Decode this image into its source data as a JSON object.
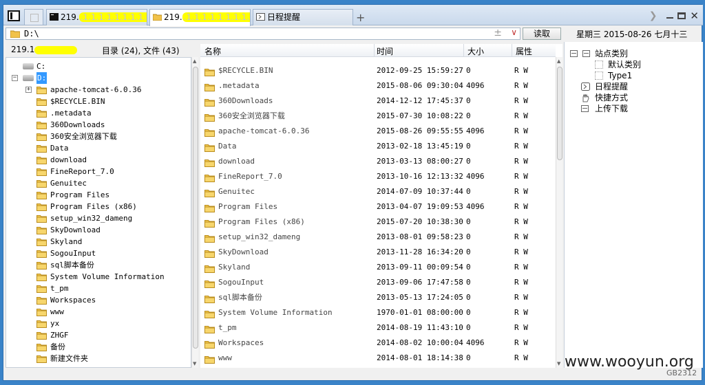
{
  "tabs": [
    {
      "label": "219.",
      "icon": "terminal-icon"
    },
    {
      "label": "219.",
      "icon": "folder-icon"
    },
    {
      "label": "日程提醒",
      "icon": "clock-icon"
    }
  ],
  "tab_add": "+",
  "toolbar": {
    "read_label": "读取"
  },
  "address": {
    "value": "D:\\"
  },
  "date_display": "星期三  2015-08-26  七月十三",
  "left": {
    "host": "219.1",
    "dir_summary": "目录 (24), 文件 (43)",
    "tree": [
      {
        "label": "C:",
        "level": "drive",
        "expand": ""
      },
      {
        "label": "D:",
        "level": "drive",
        "expand": "−",
        "selected": true
      },
      {
        "label": "apache-tomcat-6.0.36",
        "level": "folder",
        "expand": "+"
      },
      {
        "label": "$RECYCLE.BIN",
        "level": "folder",
        "expand": ""
      },
      {
        "label": ".metadata",
        "level": "folder",
        "expand": ""
      },
      {
        "label": "360Downloads",
        "level": "folder",
        "expand": ""
      },
      {
        "label": "360安全浏览器下载",
        "level": "folder",
        "expand": ""
      },
      {
        "label": "Data",
        "level": "folder",
        "expand": ""
      },
      {
        "label": "download",
        "level": "folder",
        "expand": ""
      },
      {
        "label": "FineReport_7.0",
        "level": "folder",
        "expand": ""
      },
      {
        "label": "Genuitec",
        "level": "folder",
        "expand": ""
      },
      {
        "label": "Program Files",
        "level": "folder",
        "expand": ""
      },
      {
        "label": "Program Files (x86)",
        "level": "folder",
        "expand": ""
      },
      {
        "label": "setup_win32_dameng",
        "level": "folder",
        "expand": ""
      },
      {
        "label": "SkyDownload",
        "level": "folder",
        "expand": ""
      },
      {
        "label": "Skyland",
        "level": "folder",
        "expand": ""
      },
      {
        "label": "SogouInput",
        "level": "folder",
        "expand": ""
      },
      {
        "label": "sql脚本备份",
        "level": "folder",
        "expand": ""
      },
      {
        "label": "System Volume Information",
        "level": "folder",
        "expand": ""
      },
      {
        "label": "t_pm",
        "level": "folder",
        "expand": ""
      },
      {
        "label": "Workspaces",
        "level": "folder",
        "expand": ""
      },
      {
        "label": "www",
        "level": "folder",
        "expand": ""
      },
      {
        "label": "yx",
        "level": "folder",
        "expand": ""
      },
      {
        "label": "ZHGF",
        "level": "folder",
        "expand": ""
      },
      {
        "label": "备份",
        "level": "folder",
        "expand": ""
      },
      {
        "label": "新建文件夹",
        "level": "folder",
        "expand": ""
      }
    ]
  },
  "files": {
    "columns": {
      "name": "名称",
      "time": "时间",
      "size": "大小",
      "attr": "属性"
    },
    "rows": [
      {
        "name": "$RECYCLE.BIN",
        "time": "2012-09-25 15:59:27",
        "size": "0",
        "attr": "R W"
      },
      {
        "name": ".metadata",
        "time": "2015-08-06 09:30:04",
        "size": "4096",
        "attr": "R W"
      },
      {
        "name": "360Downloads",
        "time": "2014-12-12 17:45:37",
        "size": "0",
        "attr": "R W"
      },
      {
        "name": "360安全浏览器下载",
        "time": "2015-07-30 10:08:22",
        "size": "0",
        "attr": "R W"
      },
      {
        "name": "apache-tomcat-6.0.36",
        "time": "2015-08-26 09:55:55",
        "size": "4096",
        "attr": "R W"
      },
      {
        "name": "Data",
        "time": "2013-02-18 13:45:19",
        "size": "0",
        "attr": "R W"
      },
      {
        "name": "download",
        "time": "2013-03-13 08:00:27",
        "size": "0",
        "attr": "R W"
      },
      {
        "name": "FineReport_7.0",
        "time": "2013-10-16 12:13:32",
        "size": "4096",
        "attr": "R W"
      },
      {
        "name": "Genuitec",
        "time": "2014-07-09 10:37:44",
        "size": "0",
        "attr": "R W"
      },
      {
        "name": "Program Files",
        "time": "2013-04-07 19:09:53",
        "size": "4096",
        "attr": "R W"
      },
      {
        "name": "Program Files (x86)",
        "time": "2015-07-20 10:38:30",
        "size": "0",
        "attr": "R W"
      },
      {
        "name": "setup_win32_dameng",
        "time": "2013-08-01 09:58:23",
        "size": "0",
        "attr": "R W"
      },
      {
        "name": "SkyDownload",
        "time": "2013-11-28 16:34:20",
        "size": "0",
        "attr": "R W"
      },
      {
        "name": "Skyland",
        "time": "2013-09-11 00:09:54",
        "size": "0",
        "attr": "R W"
      },
      {
        "name": "SogouInput",
        "time": "2013-09-06 17:47:58",
        "size": "0",
        "attr": "R W"
      },
      {
        "name": "sql脚本备份",
        "time": "2013-05-13 17:24:05",
        "size": "0",
        "attr": "R W"
      },
      {
        "name": "System Volume Information",
        "time": "1970-01-01 08:00:00",
        "size": "0",
        "attr": "R W"
      },
      {
        "name": "t_pm",
        "time": "2014-08-19 11:43:10",
        "size": "0",
        "attr": "R W"
      },
      {
        "name": "Workspaces",
        "time": "2014-08-02 10:00:04",
        "size": "4096",
        "attr": "R W"
      },
      {
        "name": "www",
        "time": "2014-08-01 18:14:38",
        "size": "0",
        "attr": "R W"
      }
    ]
  },
  "right": {
    "items": [
      {
        "label": "站点类别",
        "kind": "group"
      },
      {
        "label": "默认类别",
        "kind": "child"
      },
      {
        "label": "Type1",
        "kind": "child"
      },
      {
        "label": "日程提醒",
        "kind": "clock"
      },
      {
        "label": "快捷方式",
        "kind": "hand"
      },
      {
        "label": "上传下载",
        "kind": "group"
      }
    ]
  },
  "watermark": "www.wooyun.org",
  "watermark_sub": "GB2312",
  "colors": {
    "selection": "#3399ff",
    "redaction": "#ffff00",
    "desktop": "#3a83c8"
  }
}
